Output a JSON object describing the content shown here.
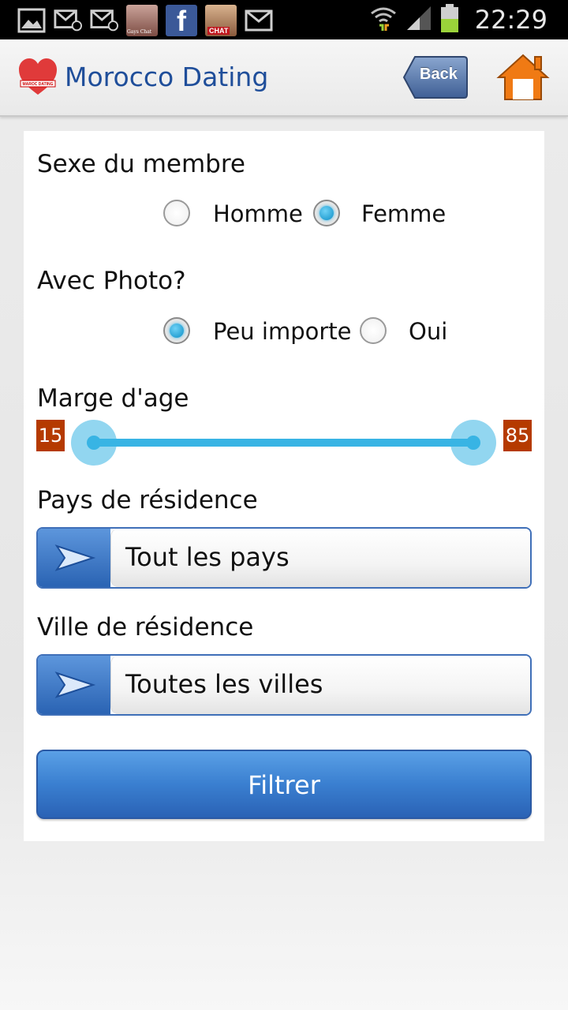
{
  "status_bar": {
    "time": "22:29",
    "notification_icons": [
      "gallery-icon",
      "email-icon",
      "email-icon",
      "gays-chat-app-icon",
      "facebook-icon",
      "chat-app-icon",
      "email-icon"
    ],
    "status_icons": [
      "wifi-icon",
      "signal-icon",
      "battery-icon"
    ]
  },
  "header": {
    "title": "Morocco Dating",
    "logo_text": "MAROC DATING",
    "back_label": "Back",
    "thumb_labels": [
      "Gays Chat",
      "CHAT"
    ]
  },
  "form": {
    "sex": {
      "label": "Sexe du membre",
      "options": [
        "Homme",
        "Femme"
      ],
      "selected": "Femme"
    },
    "photo": {
      "label": "Avec Photo?",
      "options": [
        "Peu importe",
        "Oui"
      ],
      "selected": "Peu importe"
    },
    "age": {
      "label": "Marge d'age",
      "min": "15",
      "max": "85"
    },
    "country": {
      "label": "Pays de résidence",
      "value": "Tout les pays"
    },
    "city": {
      "label": "Ville de résidence",
      "value": "Toutes les villes"
    },
    "submit_label": "Filtrer"
  },
  "colors": {
    "title": "#1f4e9a",
    "accent": "#38b4e4",
    "age_badge": "#b53a00",
    "button": "#3a7fd0",
    "home_icon": "#f07a14"
  }
}
